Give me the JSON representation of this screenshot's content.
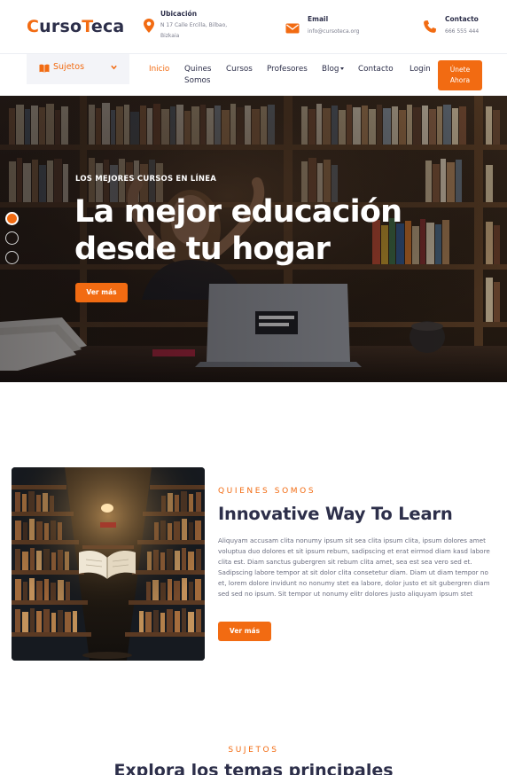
{
  "brand": {
    "logo_c": "C",
    "logo_urso": "urso",
    "logo_t": "T",
    "logo_eca": "eca",
    "accent_color": "#f26b12",
    "dark_color": "#2d2f4a"
  },
  "header": {
    "location": {
      "icon": "map-pin-icon",
      "title": "Ubicación",
      "line1": "N 17 Calle Ercilla, Bilbao,",
      "line2": "Bizkaia"
    },
    "email": {
      "icon": "envelope-icon",
      "title": "Email",
      "value": "info@cursoteca.org"
    },
    "contact": {
      "icon": "phone-icon",
      "title": "Contacto",
      "value": "666 555 444"
    }
  },
  "nav": {
    "subjects_icon": "book-open-icon",
    "subjects_label": "Sujetos",
    "items": [
      {
        "label": "Inicio",
        "active": true
      },
      {
        "label": "Quines Somos"
      },
      {
        "label": "Cursos"
      },
      {
        "label": "Profesores"
      },
      {
        "label": "Blog",
        "dropdown": true
      },
      {
        "label": "Contacto"
      },
      {
        "label": "Login"
      }
    ],
    "quines_line1": "Quines",
    "quines_line2": "Somos",
    "cta_line1": "Únete",
    "cta_line2": "Ahora"
  },
  "hero": {
    "kicker": "LOS MEJORES CURSOS EN LÍNEA",
    "title_line1": "La mejor educación",
    "title_line2": "desde tu hogar",
    "button": "Ver más",
    "slides": 3,
    "active_slide": 1
  },
  "about": {
    "eyebrow": "QUIENES SOMOS",
    "title": "Innovative Way To Learn",
    "text": "Aliquyam accusam clita nonumy ipsum sit sea clita ipsum clita, ipsum dolores amet voluptua duo dolores et sit ipsum rebum, sadipscing et erat eirmod diam kasd labore clita est. Diam sanctus gubergren sit rebum clita amet, sea est sea vero sed et. Sadipscing labore tempor at sit dolor clita consetetur diam. Diam ut diam tempor no et, lorem dolore invidunt no nonumy stet ea labore, dolor justo et sit gubergren diam sed sed no ipsum. Sit tempor ut nonumy elitr dolores justo aliquyam ipsum stet",
    "button": "Ver más"
  },
  "subjects_section": {
    "eyebrow": "SUJETOS",
    "title": "Explora los temas principales"
  }
}
